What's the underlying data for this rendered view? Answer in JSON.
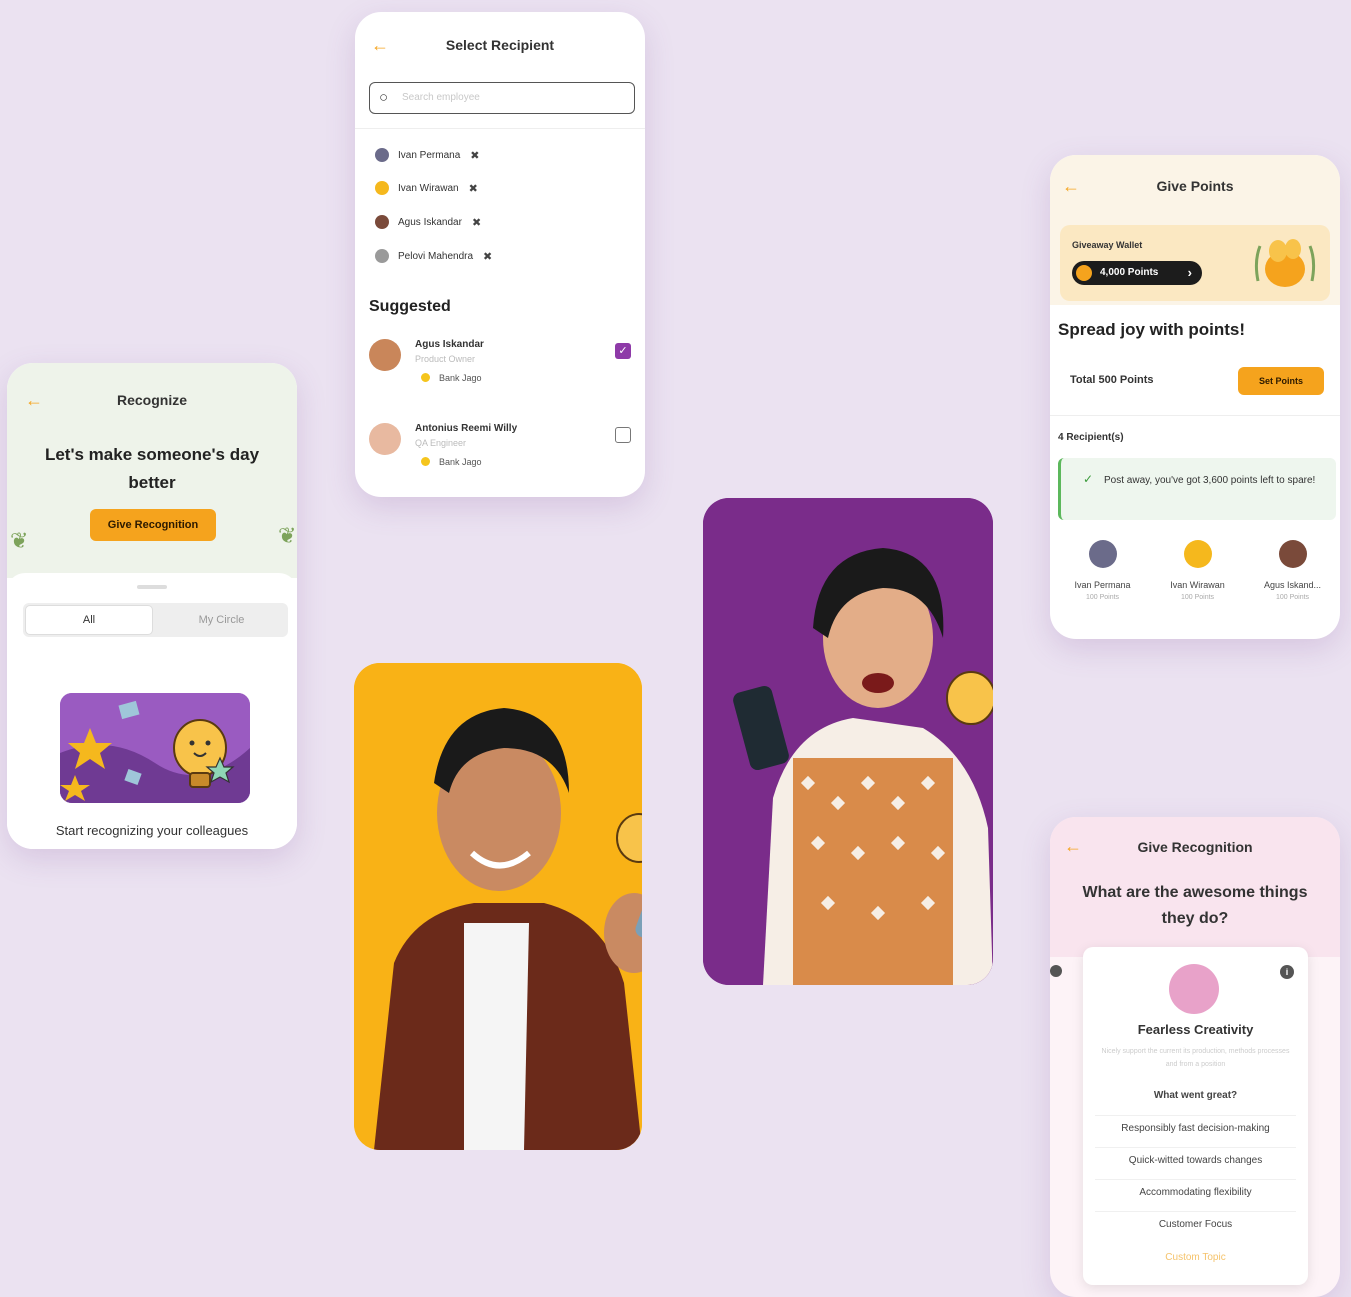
{
  "recognize": {
    "title": "Recognize",
    "headline": "Let's make someone's day better",
    "cta": "Give Recognition",
    "tabs": [
      "All",
      "My Circle"
    ],
    "empty_text": "Start recognizing your colleagues"
  },
  "select_recipient": {
    "title": "Select Recipient",
    "search_placeholder": "Search employee",
    "selected": [
      {
        "name": "Ivan Permana",
        "color": "#6b6b8a"
      },
      {
        "name": "Ivan Wirawan",
        "color": "#f5b81d"
      },
      {
        "name": "Agus Iskandar",
        "color": "#7a4a3a"
      },
      {
        "name": "Pelovi Mahendra",
        "color": "#9a9a9a"
      }
    ],
    "remove_glyph": "✖",
    "suggested_label": "Suggested",
    "suggested": [
      {
        "name": "Agus Iskandar",
        "role": "Product Owner",
        "company": "Bank Jago",
        "checked": true
      },
      {
        "name": "Antonius Reemi Willy",
        "role": "QA Engineer",
        "company": "Bank Jago",
        "checked": false
      }
    ]
  },
  "give_points": {
    "title": "Give Points",
    "wallet_label": "Giveaway Wallet",
    "wallet_points": "4,000 Points",
    "headline": "Spread joy with points!",
    "total": "Total 500 Points",
    "set_points": "Set Points",
    "recipients_label": "4 Recipient(s)",
    "alert": "Post away, you've got 3,600 points left to spare!",
    "recipients": [
      {
        "name": "Ivan Permana",
        "points": "100 Points",
        "color": "#6b6b8a"
      },
      {
        "name": "Ivan Wirawan",
        "points": "100 Points",
        "color": "#f5b81d"
      },
      {
        "name": "Agus Iskand...",
        "points": "100 Points",
        "color": "#7a4a3a"
      }
    ]
  },
  "give_recognition": {
    "title": "Give Recognition",
    "question": "What are the awesome things they do?",
    "value_name": "Fearless Creativity",
    "value_desc": "Nicely support the current its production, methods processes and from a position",
    "what_went_great": "What went great?",
    "options": [
      "Responsibly fast decision-making",
      "Quick-witted towards changes",
      "Accommodating flexibility",
      "Customer Focus"
    ],
    "custom": "Custom Topic"
  },
  "colors": {
    "background": "#ebe2f1",
    "accent_orange": "#f5a31d",
    "purple": "#7a2c8a",
    "yellow": "#f9b216",
    "checkbox_purple": "#8e3aa8"
  }
}
